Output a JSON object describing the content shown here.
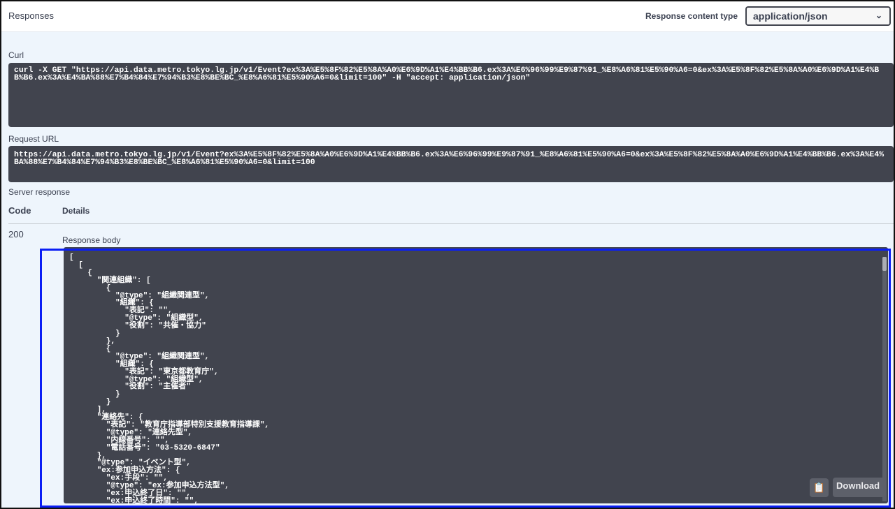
{
  "header": {
    "title": "Responses",
    "content_type_label": "Response content type",
    "content_type_value": "application/json"
  },
  "curl": {
    "label": "Curl",
    "command": "curl -X GET \"https://api.data.metro.tokyo.lg.jp/v1/Event?ex%3A%E5%8F%82%E5%8A%A0%E6%9D%A1%E4%BB%B6.ex%3A%E6%96%99%E9%87%91_%E8%A6%81%E5%90%A6=0&ex%3A%E5%8F%82%E5%8A%A0%E6%9D%A1%E4%BB%B6.ex%3A%E4%BA%88%E7%B4%84%E7%94%B3%E8%BE%BC_%E8%A6%81%E5%90%A6=0&limit=100\" -H \"accept: application/json\""
  },
  "request_url": {
    "label": "Request URL",
    "value": "https://api.data.metro.tokyo.lg.jp/v1/Event?ex%3A%E5%8F%82%E5%8A%A0%E6%9D%A1%E4%BB%B6.ex%3A%E6%96%99%E9%87%91_%E8%A6%81%E5%90%A6=0&ex%3A%E5%8F%82%E5%8A%A0%E6%9D%A1%E4%BB%B6.ex%3A%E4%BA%88%E7%B4%84%E7%94%B3%E8%BE%BC_%E8%A6%81%E5%90%A6=0&limit=100"
  },
  "server_response": {
    "label": "Server response",
    "code_header": "Code",
    "details_header": "Details",
    "code": "200",
    "body_label": "Response body"
  },
  "response_body": "[\n  [\n    {\n      \"関連組織\": [\n        {\n          \"@type\": \"組織関連型\",\n          \"組織\": {\n            \"表記\": \"\",\n            \"@type\": \"組織型\",\n            \"役割\": \"共催・協力\"\n          }\n        },\n        {\n          \"@type\": \"組織関連型\",\n          \"組織\": {\n            \"表記\": \"東京都教育庁\",\n            \"@type\": \"組織型\",\n            \"役割\": \"主催者\"\n          }\n        }\n      ],\n      \"連絡先\": {\n        \"表記\": \"教育庁指導部特別支援教育指導課\",\n        \"@type\": \"連絡先型\",\n        \"内線番号\": \"\",\n        \"電話番号\": \"03-5320-6847\"\n      },\n      \"@type\": \"イベント型\",\n      \"ex:参加申込方法\": {\n        \"ex:手段\": \"\",\n        \"@type\": \"ex:参加申込方法型\",\n        \"ex:申込終了日\": \"\",\n        \"ex:申込終了時間\": \"\",",
  "buttons": {
    "download": "Download"
  }
}
